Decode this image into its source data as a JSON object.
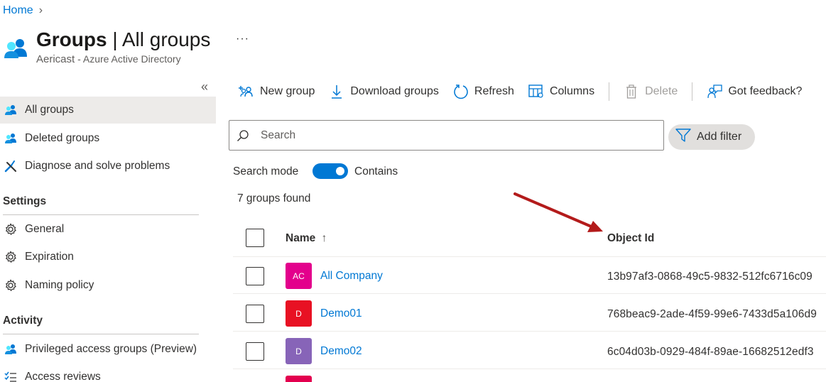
{
  "breadcrumb": {
    "home": "Home",
    "separator": "›"
  },
  "header": {
    "title_main": "Groups",
    "title_separator": " | ",
    "title_sub": "All groups",
    "tenant": "Aericast",
    "directory": " - Azure Active Directory",
    "more": "···"
  },
  "sidebar": {
    "collapse": "«",
    "items": [
      {
        "label": "All groups",
        "icon": "groups-icon",
        "active": true
      },
      {
        "label": "Deleted groups",
        "icon": "groups-icon"
      },
      {
        "label": "Diagnose and solve problems",
        "icon": "wrench-icon"
      }
    ],
    "settings_heading": "Settings",
    "settings_items": [
      {
        "label": "General",
        "icon": "gear-icon"
      },
      {
        "label": "Expiration",
        "icon": "gear-icon"
      },
      {
        "label": "Naming policy",
        "icon": "gear-icon"
      }
    ],
    "activity_heading": "Activity",
    "activity_items": [
      {
        "label": "Privileged access groups (Preview)",
        "icon": "groups-icon"
      },
      {
        "label": "Access reviews",
        "icon": "checklist-icon"
      }
    ]
  },
  "toolbar": {
    "new_group": "New group",
    "download_groups": "Download groups",
    "refresh": "Refresh",
    "columns": "Columns",
    "delete": "Delete",
    "feedback": "Got feedback?"
  },
  "search": {
    "placeholder": "Search",
    "value": ""
  },
  "filter": {
    "add_filter": "Add filter"
  },
  "search_mode": {
    "label": "Search mode",
    "toggle_label": "Contains",
    "enabled": true
  },
  "result_count": "7 groups found",
  "table": {
    "columns": {
      "name": "Name",
      "sort_indicator": "↑",
      "object_id": "Object Id"
    },
    "rows": [
      {
        "initials": "AC",
        "name": "All Company",
        "object_id": "13b97af3-0868-49c5-9832-512fc6716c09",
        "color": "#e3008c"
      },
      {
        "initials": "D",
        "name": "Demo01",
        "object_id": "768beac9-2ade-4f59-99e6-7433d5a106d9",
        "color": "#e81123"
      },
      {
        "initials": "D",
        "name": "Demo02",
        "object_id": "6c04d03b-0929-484f-89ae-16682512edf3",
        "color": "#8764b8"
      },
      {
        "initials": "",
        "name": "",
        "object_id": "",
        "color": "#e3004f"
      }
    ]
  },
  "colors": {
    "accent": "#0078d4",
    "annotation_arrow": "#b31b1b"
  }
}
